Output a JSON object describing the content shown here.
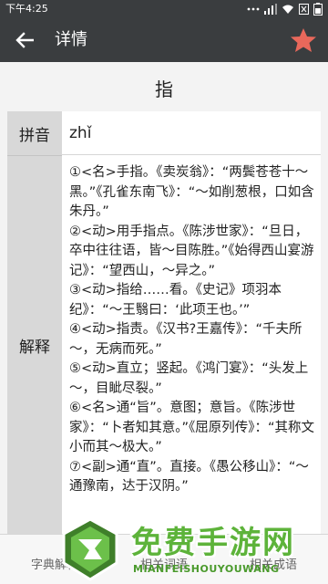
{
  "status_bar": {
    "time": "下午4:25"
  },
  "app_bar": {
    "title": "详情",
    "back_icon": "arrow-left-icon",
    "favorite_icon": "star-icon",
    "favorite_color": "#e9685b"
  },
  "entry": {
    "character": "指",
    "pinyin_label": "拼音",
    "pinyin": "zhǐ",
    "definition_label": "解释",
    "definition": "①<名>手指。《卖炭翁》：“两鬓苍苍十～黑。”《孔雀东南飞》：“～如削葱根，口如含朱丹。”\n②<动>用手指点。《陈涉世家》：“旦日，卒中往往语，皆～目陈胜。”《始得西山宴游记》：“望西山，～异之。”\n③<动>指给……看。《史记》项羽本纪》：“～王翳曰：‘此项王也。’”\n④<动>指责。《汉书?王嘉传》：“千夫所～，无病而死。”\n⑤<动>直立；竖起。《鸿门宴》：“头发上～，目眦尽裂。”\n⑥<名>通“旨”。意图；意旨。《陈涉世家》：“卜者知其意。”《屈原列传》：“其称文小而其～极大。”\n⑦<副>通“直”。直接。《愚公移山》：“～通豫南，达于汉阴。”"
  },
  "tabs": [
    {
      "label": "字典解释"
    },
    {
      "label": "相关词语"
    },
    {
      "label": "相关成语"
    }
  ],
  "watermark": {
    "title": "免费手游网",
    "subtitle": "MIANFEISHOUYOUWANG"
  }
}
